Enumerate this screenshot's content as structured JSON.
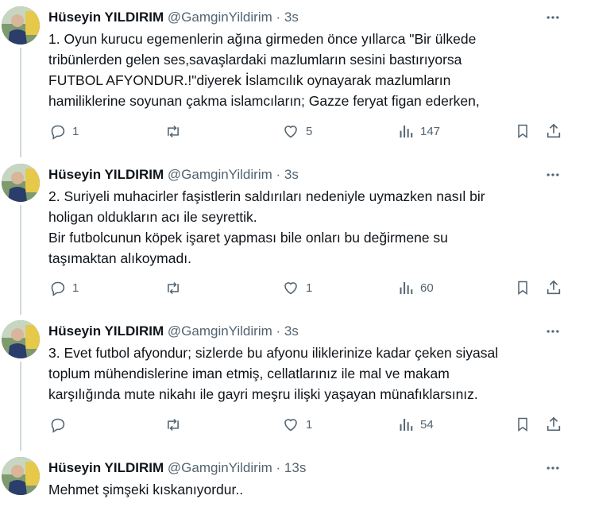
{
  "tweets": [
    {
      "name": "Hüseyin YILDIRIM",
      "handle": "@GamginYildirim",
      "separator": "·",
      "time": "3s",
      "lines": [
        "1. Oyun kurucu egemenlerin ağına girmeden önce yıllarca \"Bir ülkede",
        "tribünlerden  gelen ses,savaşlardaki mazlumların sesini bastırıyorsa",
        "FUTBOL AFYONDUR.!\"diyerek İslamcılık oynayarak mazlumların",
        "hamiliklerine soyunan çakma islamcıların; Gazze feryat figan ederken,"
      ],
      "replies": "1",
      "reposts": "",
      "likes": "5",
      "views": "147"
    },
    {
      "name": "Hüseyin YILDIRIM",
      "handle": "@GamginYildirim",
      "separator": "·",
      "time": "3s",
      "lines": [
        "2. Suriyeli muhacirler faşistlerin saldırıları nedeniyle uymazken nasıl bir",
        "holigan oldukların acı ile seyrettik.",
        "Bir futbolcunun köpek işaret yapması bile onları bu değirmene su",
        "taşımaktan alıkoymadı."
      ],
      "replies": "1",
      "reposts": "",
      "likes": "1",
      "views": "60"
    },
    {
      "name": "Hüseyin YILDIRIM",
      "handle": "@GamginYildirim",
      "separator": "·",
      "time": "3s",
      "lines": [
        "3. Evet futbol afyondur; sizlerde bu afyonu iliklerinize kadar çeken siyasal",
        "toplum mühendislerine iman etmiş, cellatlarınız ile mal ve makam",
        "karşılığında mute nikahı ile gayri meşru ilişki yaşayan münafıklarsınız."
      ],
      "replies": "",
      "reposts": "",
      "likes": "1",
      "views": "54"
    },
    {
      "name": "Hüseyin YILDIRIM",
      "handle": "@GamginYildirim",
      "separator": "·",
      "time": "13s",
      "lines": [
        "Mehmet şimşeki kıskanıyordur.."
      ]
    }
  ],
  "icons": {
    "reply": "reply-icon",
    "repost": "repost-icon",
    "like": "like-icon",
    "views": "views-icon",
    "bookmark": "bookmark-icon",
    "share": "share-icon",
    "more": "more-icon"
  },
  "colors": {
    "text": "#0f1419",
    "secondary": "#536471",
    "thread_line": "#cfd9de"
  }
}
